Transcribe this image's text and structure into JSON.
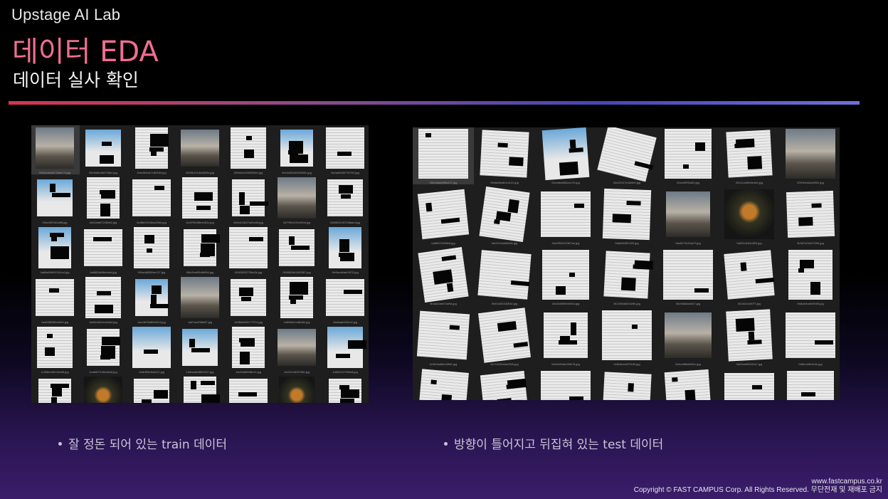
{
  "header": {
    "brand": "Upstage AI Lab",
    "title": "데이터 EDA",
    "subtitle": "데이터 실사 확인"
  },
  "colors": {
    "title": "#ef6f8e",
    "rule_start": "#d4354f",
    "rule_end": "#7070d8"
  },
  "train_panel": {
    "files": [
      "008d1a6b8278dbc74.jpg",
      "00e9a8b4b8728ee.jpg",
      "00ac5b4dc7c88180.jpg",
      "00f0fb12e4a9820b.jpg",
      "009ab0c4983f28e0.jpg",
      "0e1bd83c5248405c.jpg",
      "0a4ad5d367947b0.jpg",
      "004c0f87d0c8f8.jpg",
      "0d42afa67248de0.jpg",
      "0e88e0110bea20bb.jpg",
      "0c4f7f5288ee461c.jpg",
      "048cb13627a61e08.jpg",
      "0d79f9c203c0006.jpg",
      "0488031497038aed.jpg",
      "0a68a908f42181e4.jpg",
      "0af8826e5feb4ed.jpg",
      "0f3a4d8382ee127.jpg",
      "0f6c2be82b8d90d.jpg",
      "0f163833275bd2e.jpg",
      "0540650b1182857.jpg",
      "0fe9acd6abf1870.jpg",
      "1a483828f0c4542.jpg",
      "1a80ed8d1ee6ddd.jpg",
      "1ae1f878d8949f13.jpg",
      "1a67ac2f48e87.jpg",
      "1d98db893177074.jpg",
      "1d698a11c68d62.jpg",
      "1ba6adb932e1f.jpg",
      "1c268ede8116a08.jpg",
      "1cdb8271d5ad0c8.jpg",
      "1c8ef59e8d4c21.jpg",
      "1d5beab0f801327.jpg",
      "1dc83a850f8c41.jpg",
      "1d2041169f7d9e.jpg",
      "1d834207058e8.jpg",
      "1e4a7e1b2c31.jpg",
      "1e9bcf1d2a47.jpg",
      "1f0a8e3c22b1.jpg",
      "1f3b6c0e9d15.jpg",
      "1f5a2e8d0c74.jpg",
      "1f8d3a6e21c9.jpg",
      "1fa0c4b7d3e2.jpg"
    ]
  },
  "test_panel": {
    "files": [
      "00b3d8ad8f5b427.jpg",
      "00b6e8bdb0c4131.jpg",
      "00c0dbb883a1e7b.jpg",
      "00c22047e3fa9e0.jpg",
      "00dcd9f92a53.jpg",
      "00e11cb9fe8e4e6.jpg",
      "00f194e62a2f902.jpg",
      "0a8f607e05fe8.jpg",
      "0a037e4a5b5df4.jpg",
      "0a42f50242387ab.jpg",
      "0a6d0e802325.jpg",
      "0ae827fe43ae7f.jpg",
      "0a92e3e54c853.jpg",
      "0b367e0d1b7056.jpg",
      "0b4ae2ab47ad9a.jpg",
      "0b40d250183f4e.jpg",
      "0b02bb5f8e0e50d.jpg",
      "0b2258d8020a9b.jpg",
      "0b2fd8a8a4d47.jpg",
      "0b2d2c0a97f7.jpg",
      "0b8cd0ba0d904b.jpg",
      "0c5b0ba8fee0880.jpg",
      "0c7c3150d4a252b.jpg",
      "0c6b0908a788b78.jpg",
      "0c80dbcdd75183.jpg",
      "0c8cc8f8a82b0c.jpg",
      "0d02ea9f0542a7.jpg",
      "0d8e1a9b4b4e.jpg",
      "0d9a1c2e4f3b.jpg",
      "0da4e7b2c1f8.jpg",
      "0db3c5e8a2d1.jpg",
      "0dc6a9e3f4b2.jpg",
      "0dd2e8b4c7a1.jpg",
      "0de5f1a3b9c6.jpg",
      "0df8c2e6a4b3.jpg"
    ]
  },
  "captions": {
    "train": "잘 정돈 되어 있는 train 데이터",
    "test": "방향이 틀어지고 뒤집혀 있는 test 데이터"
  },
  "footer": {
    "url": "www.fastcampus.co.kr",
    "copyright": "Copyright © FAST CAMPUS Corp. All Rights Reserved. 무단전재 및 재배포 금지"
  }
}
